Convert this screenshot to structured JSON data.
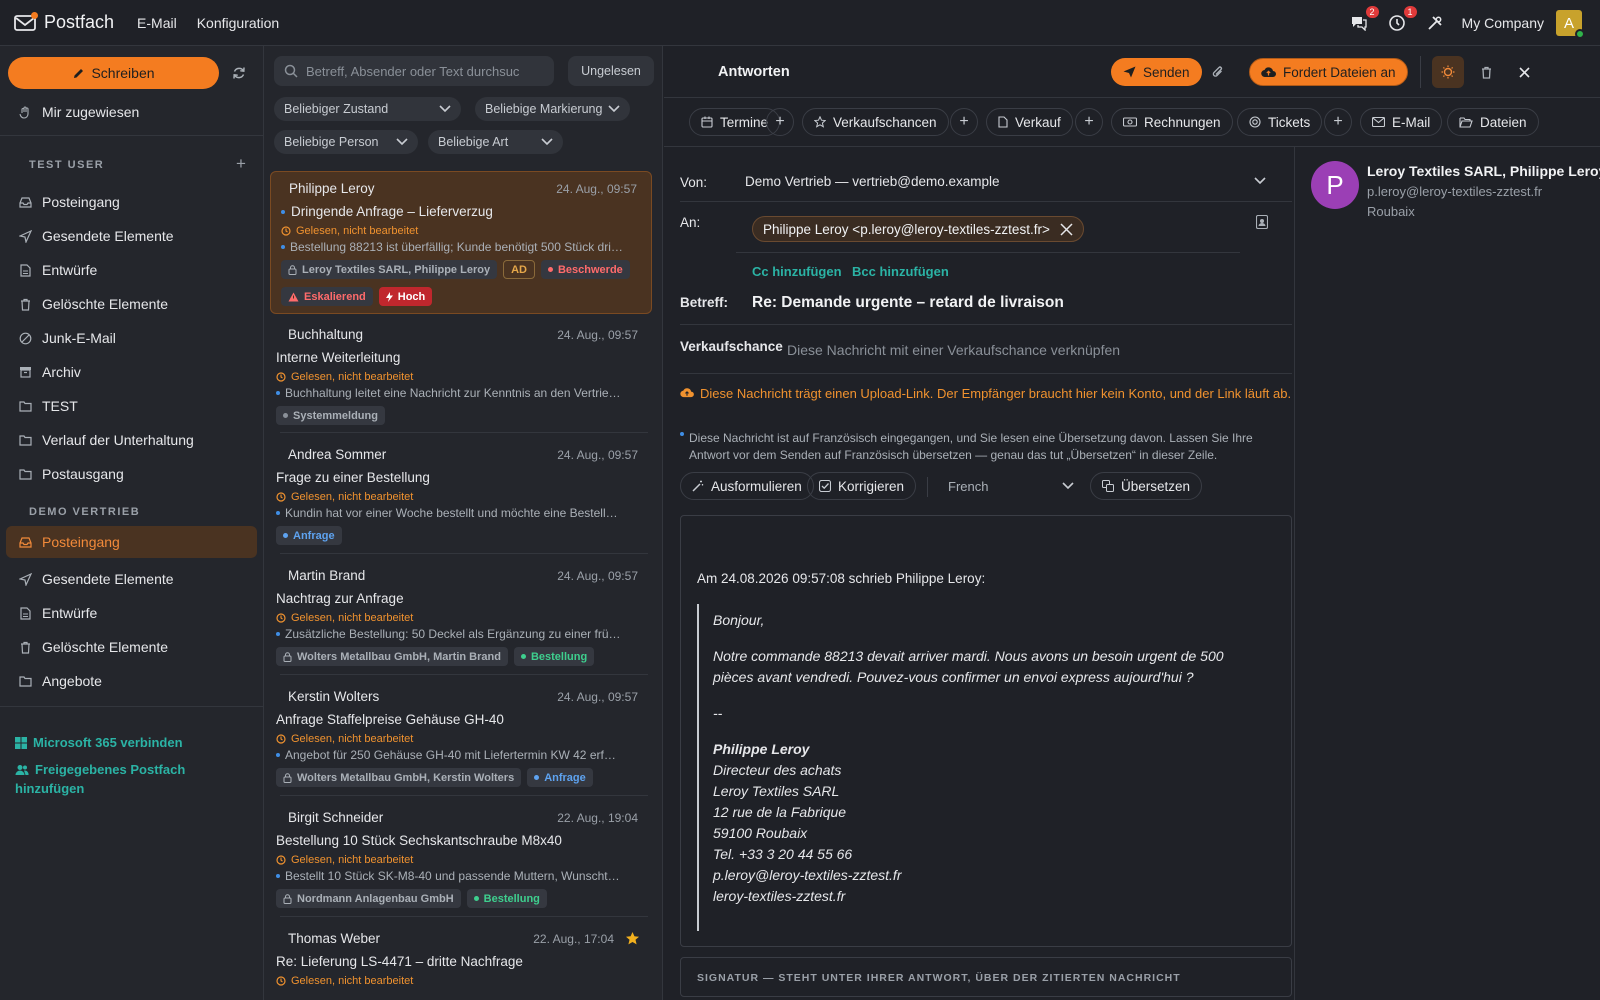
{
  "topbar": {
    "app_title": "Postfach",
    "nav": [
      "E-Mail",
      "Konfiguration"
    ],
    "chat_badge": "2",
    "activity_badge": "1",
    "company": "My Company",
    "avatar_initial": "A"
  },
  "sidebar": {
    "compose_label": "Schreiben",
    "assigned_label": "Mir zugewiesen",
    "section1_title": "TEST USER",
    "section1_items": [
      "Posteingang",
      "Gesendete Elemente",
      "Entwürfe",
      "Gelöschte Elemente",
      "Junk-E-Mail",
      "Archiv",
      "TEST",
      "Verlauf der Unterhaltung",
      "Postausgang"
    ],
    "section2_title": "DEMO VERTRIEB",
    "section2_items": [
      "Posteingang",
      "Gesendete Elemente",
      "Entwürfe",
      "Gelöschte Elemente",
      "Angebote"
    ],
    "ms365_link": "Microsoft 365 verbinden",
    "shared_link_1": "Freigegebenes Postfach",
    "shared_link_2": "hinzufügen"
  },
  "list": {
    "search_placeholder": "Betreff, Absender oder Text durchsuc",
    "unread_label": "Ungelesen",
    "filters": [
      "Beliebiger Zustand",
      "Beliebige Markierung",
      "Beliebige Person",
      "Beliebige Art"
    ],
    "status_text": "Gelesen, nicht bearbeitet",
    "mails": [
      {
        "sender": "Philippe Leroy",
        "date": "24. Aug., 09:57",
        "subject": "Dringende Anfrage – Lieferverzug",
        "preview": "Bestellung 88213 ist überfällig; Kunde benötigt 500 Stück dri…",
        "tag_company": "Leroy Textiles SARL, Philippe Leroy",
        "tag_ad": "AD",
        "tag_cat": "Beschwerde",
        "tag_esk": "Eskalierend",
        "tag_prio": "Hoch"
      },
      {
        "sender": "Buchhaltung",
        "date": "24. Aug., 09:57",
        "subject": "Interne Weiterleitung",
        "preview": "Buchhaltung leitet eine Nachricht zur Kenntnis an den Vertrie…",
        "tag_cat": "Systemmeldung"
      },
      {
        "sender": "Andrea Sommer",
        "date": "24. Aug., 09:57",
        "subject": "Frage zu einer Bestellung",
        "preview": "Kundin hat vor einer Woche bestellt und möchte eine Bestell…",
        "tag_cat": "Anfrage"
      },
      {
        "sender": "Martin Brand",
        "date": "24. Aug., 09:57",
        "subject": "Nachtrag zur Anfrage",
        "preview": "Zusätzliche Bestellung: 50 Deckel als Ergänzung zu einer frü…",
        "tag_company": "Wolters Metallbau GmbH, Martin Brand",
        "tag_cat": "Bestellung"
      },
      {
        "sender": "Kerstin Wolters",
        "date": "24. Aug., 09:57",
        "subject": "Anfrage Staffelpreise Gehäuse GH-40",
        "preview": "Angebot für 250 Gehäuse GH-40 mit Liefertermin KW 42 erf…",
        "tag_company": "Wolters Metallbau GmbH, Kerstin Wolters",
        "tag_cat": "Anfrage"
      },
      {
        "sender": "Birgit Schneider",
        "date": "22. Aug., 19:04",
        "subject": "Bestellung 10 Stück Sechskantschraube M8x40",
        "preview": "Bestellt 10 Stück SK-M8-40 und passende Muttern, Wunscht…",
        "tag_company": "Nordmann Anlagenbau GmbH",
        "tag_cat": "Bestellung"
      },
      {
        "sender": "Thomas Weber",
        "date": "22. Aug., 17:04",
        "subject": "Re: Lieferung LS-4471 – dritte Nachfrage",
        "status": "Gelesen, nicht bearbeitet"
      }
    ]
  },
  "compose": {
    "title": "Antworten",
    "send_label": "Senden",
    "request_files_label": "Fordert Dateien an",
    "tabs": [
      "Termine",
      "Verkaufschancen",
      "Verkauf",
      "Rechnungen",
      "Tickets",
      "E-Mail",
      "Dateien"
    ],
    "from_label": "Von:",
    "from_value": "Demo Vertrieb — vertrieb@demo.example",
    "to_label": "An:",
    "to_chip": "Philippe Leroy <p.leroy@leroy-textiles-zztest.fr>",
    "cc_label": "Cc hinzufügen",
    "bcc_label": "Bcc hinzufügen",
    "subject_label": "Betreff:",
    "subject_value": "Re: Demande urgente – retard de livraison",
    "opportunity_label": "Verkaufschance",
    "opportunity_placeholder": "Diese Nachricht mit einer Verkaufschance verknüpfen",
    "upload_warning": "Diese Nachricht trägt einen Upload-Link. Der Empfänger braucht hier kein Konto, und der Link läuft ab.",
    "translation_info": "Diese Nachricht ist auf Französisch eingegangen, und Sie lesen eine Übersetzung davon. Lassen Sie Ihre Antwort vor dem Senden auf Französisch übersetzen — genau das tut „Übersetzen“ in dieser Zeile.",
    "btn_formulate": "Ausformulieren",
    "btn_correct": "Korrigieren",
    "language": "French",
    "btn_translate": "Übersetzen",
    "quote_header": "Am 24.08.2026 09:57:08 schrieb Philippe Leroy:",
    "quote_greeting": "Bonjour,",
    "quote_body": "Notre commande 88213 devait arriver mardi. Nous avons un besoin urgent de 500 pièces avant vendredi. Pouvez-vous confirmer un envoi express aujourd'hui ?",
    "quote_dash": "--",
    "sig_name": "Philippe Leroy",
    "sig_lines": [
      "Directeur des achats",
      "Leroy Textiles SARL",
      "12 rue de la Fabrique",
      "59100 Roubaix",
      "Tel. +33 3 20 44 55 66",
      "p.leroy@leroy-textiles-zztest.fr",
      "leroy-textiles-zztest.fr"
    ],
    "signature_bar": "SIGNATUR — STEHT UNTER IHRER ANTWORT, ÜBER DER ZITIERTEN NACHRICHT"
  },
  "contact": {
    "initial": "P",
    "name": "Leroy Textiles SARL, Philippe Leroy",
    "email": "p.leroy@leroy-textiles-zztest.fr",
    "city": "Roubaix"
  },
  "colors": {
    "accent": "#f47c20",
    "teal": "#2bb3a5",
    "danger": "#c0272d",
    "background": "#1f2127"
  }
}
